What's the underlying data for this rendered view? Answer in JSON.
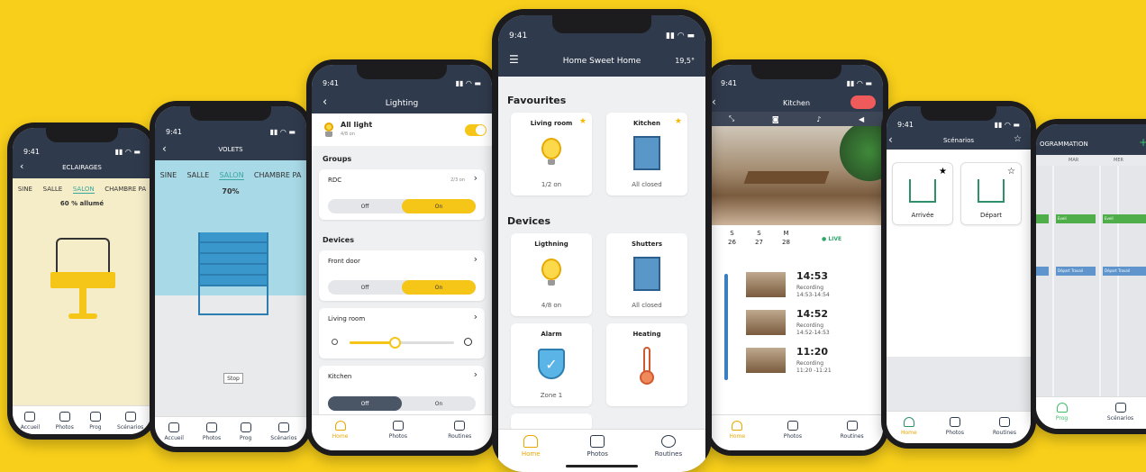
{
  "p1": {
    "title": "ECLAIRAGES",
    "time": "9:41",
    "rooms": [
      "SINE",
      "SALLE",
      "SALON",
      "CHAMBRE PA"
    ],
    "active_room": "SALON",
    "status": "60 % allumé",
    "tabs": [
      "Accueil",
      "Photos",
      "Prog",
      "Scénarios"
    ]
  },
  "p2": {
    "title": "VOLETS",
    "time": "9:41",
    "rooms": [
      "SINE",
      "SALLE",
      "SALON",
      "CHAMBRE PA"
    ],
    "active_room": "SALON",
    "percent": "70%",
    "stop": "Stop",
    "tabs": [
      "Accueil",
      "Photos",
      "Prog",
      "Scénarios"
    ]
  },
  "p3": {
    "title": "Lighting",
    "time": "9:41",
    "all_light": "All light",
    "all_sub": "4/8 on",
    "groups": "Groups",
    "rdc": "RDC",
    "rdc_count": "2/3 on",
    "off": "Off",
    "on": "On",
    "devices": "Devices",
    "front_door": "Front door",
    "living_room": "Living room",
    "kitchen": "Kitchen",
    "tabs": [
      "Home",
      "Photos",
      "Routines"
    ]
  },
  "p4": {
    "title": "Home Sweet Home",
    "time": "9:41",
    "temp": "19,5°",
    "favourites": "Favourites",
    "devices": "Devices",
    "fav": [
      {
        "name": "Living room",
        "status": "1/2 on"
      },
      {
        "name": "Kitchen",
        "status": "All closed"
      }
    ],
    "dev": [
      {
        "name": "Ligthning",
        "status": "4/8 on"
      },
      {
        "name": "Shutters",
        "status": "All closed"
      },
      {
        "name": "Alarm",
        "status": "Zone 1"
      },
      {
        "name": "Heating",
        "status": ""
      }
    ],
    "tabs": [
      "Home",
      "Photos",
      "Routines"
    ]
  },
  "p5": {
    "title": "Kitchen",
    "time": "9:41",
    "days": [
      {
        "d": "S",
        "n": "26"
      },
      {
        "d": "S",
        "n": "27"
      },
      {
        "d": "M",
        "n": "28"
      }
    ],
    "live": "LIVE",
    "recs": [
      {
        "t": "14:53",
        "l": "Recording",
        "r": "14:53-14:54"
      },
      {
        "t": "14:52",
        "l": "Recording",
        "r": "14:52-14:53"
      },
      {
        "t": "11:20",
        "l": "Recording",
        "r": "11:20 -11:21"
      }
    ],
    "tabs": [
      "Home",
      "Photos",
      "Routines"
    ]
  },
  "p6": {
    "title": "Scénarios",
    "time": "9:41",
    "s1": "Arrivée",
    "s2": "Départ",
    "tabs": [
      "Home",
      "Photos",
      "Routines"
    ]
  },
  "p7": {
    "title": "OGRAMMATION",
    "cols": [
      "MAR",
      "MER"
    ],
    "ev1": "Eveil",
    "ev2": "Départ Travail",
    "tabs": [
      "Prog",
      "Scénarios"
    ]
  }
}
